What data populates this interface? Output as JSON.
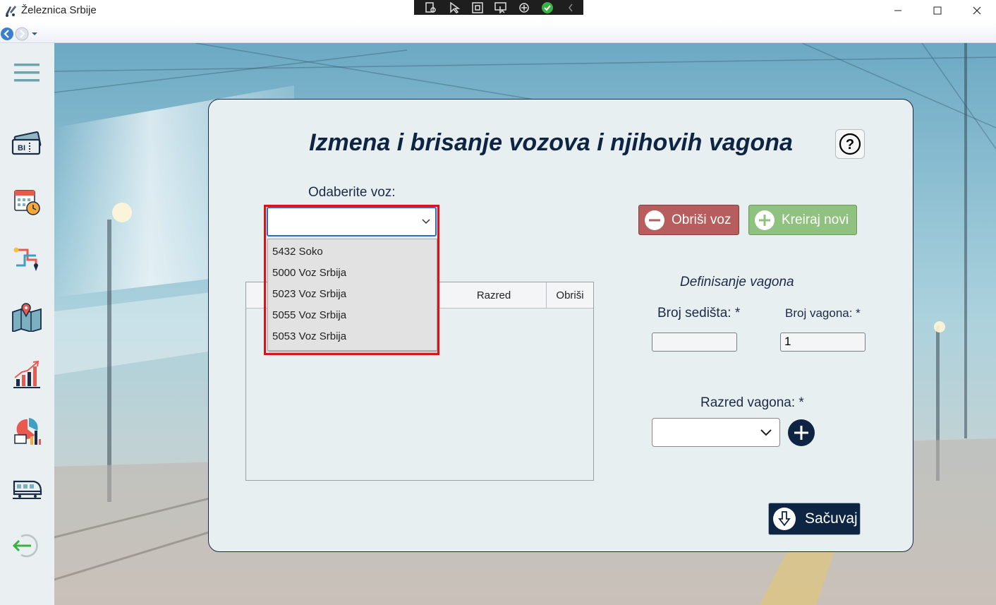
{
  "window": {
    "title": "Železnica Srbije"
  },
  "page": {
    "title": "Izmena i brisanje vozova i njihovih vagona"
  },
  "train_select": {
    "label": "Odaberite voz:",
    "value": "",
    "options": [
      "5432 Soko",
      "5000 Voz Srbija",
      "5023 Voz Srbija",
      "5055 Voz Srbija",
      "5053 Voz Srbija"
    ]
  },
  "table": {
    "columns": {
      "class": "Razred",
      "delete": "Obriši"
    }
  },
  "buttons": {
    "delete_train": "Obriši voz",
    "create_new": "Kreiraj novi",
    "save": "Sačuvaj"
  },
  "wagon_form": {
    "section_label": "Definisanje vagona",
    "seats_label": "Broj sedišta: *",
    "seats_value": "",
    "wagon_number_label": "Broj vagona: *",
    "wagon_number_value": "1",
    "class_label": "Razred vagona: *",
    "class_value": ""
  },
  "sidebar_icons": [
    "menu-icon",
    "ticket-icon",
    "calendar-icon",
    "route-icon",
    "map-icon",
    "chart-icon",
    "report-icon",
    "train-icon",
    "logout-icon"
  ],
  "colors": {
    "accent_navy": "#0d2443",
    "delete_red": "#b85d5d",
    "create_green": "#8fc27e",
    "highlight_red": "#d8141b"
  }
}
